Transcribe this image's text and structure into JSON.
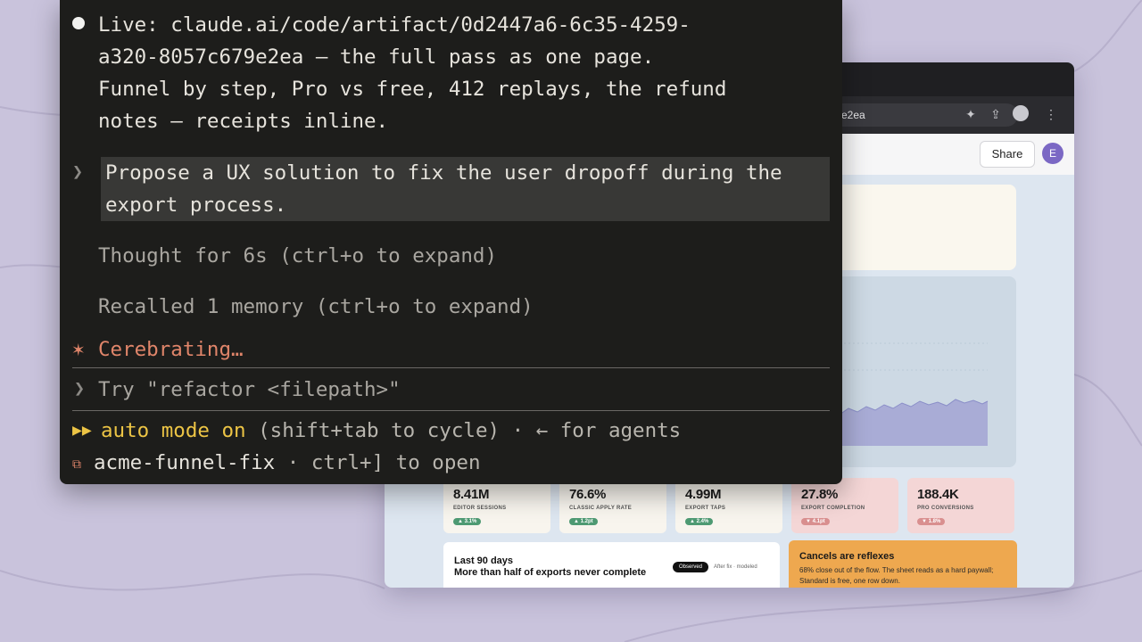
{
  "terminal": {
    "live_line1": "Live: claude.ai/code/artifact/0d2447a6-6c35-4259-",
    "live_line2": "a320-8057c679e2ea — the full pass as one page.",
    "live_line3": "Funnel by step, Pro vs free, 412 replays, the refund",
    "live_line4": "notes — receipts inline.",
    "prompt_line1": "Propose a UX solution to fix the user dropoff during the",
    "prompt_line2": "export process.",
    "thought": "Thought for 6s (ctrl+o to expand)",
    "recalled": "Recalled 1 memory (ctrl+o to expand)",
    "status_star": "✶",
    "status": "Cerebrating…",
    "input_placeholder": "Try \"refactor <filepath>\"",
    "mode_arrows": "▶▶",
    "mode_label": "auto mode on",
    "mode_hint": " (shift+tab to cycle) · ← for agents",
    "session_name": "acme-funnel-fix",
    "session_hint": " · ctrl+] to open"
  },
  "browser": {
    "url_tail": "e2ea",
    "share_label": "Share",
    "avatar_letter": "E"
  },
  "metrics": [
    {
      "value": "8.41M",
      "label": "EDITOR SESSIONS",
      "delta": "▲ 3.1%"
    },
    {
      "value": "76.6%",
      "label": "CLASSIC APPLY RATE",
      "delta": "▲ 1.2pt"
    },
    {
      "value": "4.99M",
      "label": "EXPORT TAPS",
      "delta": "▲ 2.4%"
    },
    {
      "value": "27.8%",
      "label": "EXPORT COMPLETION",
      "delta": "▼ 4.1pt"
    },
    {
      "value": "188.4K",
      "label": "PRO CONVERSIONS",
      "delta": "▼ 1.8%"
    }
  ],
  "days_card": {
    "title": "Last 90 days",
    "subtitle": "More than half of exports never complete",
    "seg_on": "Observed",
    "seg_off": "After fix · modeled"
  },
  "orange_card": {
    "title": "Cancels are reflexes",
    "text_line1": "68% close out of the flow. The sheet reads as a hard paywall;",
    "text_line2": "Standard is free, one row down."
  },
  "colors": {
    "terminal_bg": "#1d1d1b",
    "accent_orange": "#e0856a",
    "accent_yellow": "#ecc445",
    "page_bg": "#c9c3dc"
  }
}
